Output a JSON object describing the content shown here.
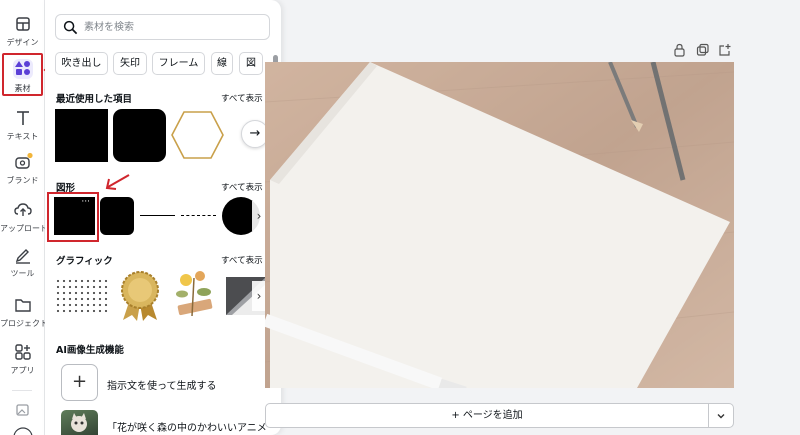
{
  "rail": {
    "items": [
      {
        "label": "デザイン",
        "icon": "layout-icon"
      },
      {
        "label": "素材",
        "icon": "elements-icon"
      },
      {
        "label": "テキスト",
        "icon": "text-icon"
      },
      {
        "label": "ブランド",
        "icon": "brand-icon"
      },
      {
        "label": "アップロード",
        "icon": "upload-icon"
      },
      {
        "label": "ツール",
        "icon": "draw-icon"
      },
      {
        "label": "プロジェクト",
        "icon": "folder-icon"
      },
      {
        "label": "アプリ",
        "icon": "apps-icon"
      }
    ]
  },
  "panel": {
    "search_placeholder": "素材を検索",
    "chips": [
      "吹き出し",
      "矢印",
      "フレーム",
      "線",
      "図"
    ],
    "recent_title": "最近使用した項目",
    "shapes_title": "図形",
    "graphics_title": "グラフィック",
    "ai_title": "AI画像生成機能",
    "see_all": "すべて表示",
    "more_dots": "···",
    "ai_prompt_label": "指示文を使って生成する",
    "ai_example_label": "「花が咲く森の中のかわいいアニメ"
  },
  "canvas": {
    "add_page_label": "+ ページを追加"
  },
  "colors": {
    "accent": "#7d2ae8",
    "highlight": "#d0262d",
    "gold": "#c9a04a"
  }
}
